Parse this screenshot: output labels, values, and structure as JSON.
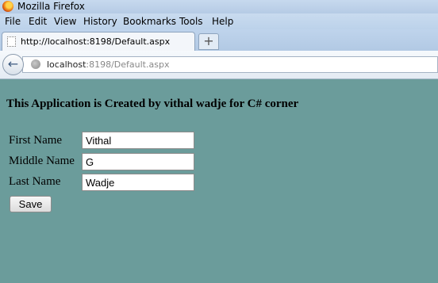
{
  "window": {
    "title": "Mozilla Firefox"
  },
  "menu": [
    "File",
    "Edit",
    "View",
    "History",
    "Bookmarks",
    "Tools",
    "Help"
  ],
  "tab": {
    "label": "http://localhost:8198/Default.aspx",
    "new_tab_symbol": "+"
  },
  "nav": {
    "back_symbol": "←",
    "url_host": "localhost",
    "url_rest": ":8198/Default.aspx"
  },
  "page": {
    "heading": "This Application is Created by vithal wadje for C# corner",
    "labels": {
      "first": "First Name",
      "middle": "Middle Name",
      "last": "Last Name"
    },
    "values": {
      "first": "Vithal",
      "middle": "G",
      "last": "Wadje"
    },
    "save_label": "Save"
  },
  "colors": {
    "page_background": "#6b9c9b"
  }
}
